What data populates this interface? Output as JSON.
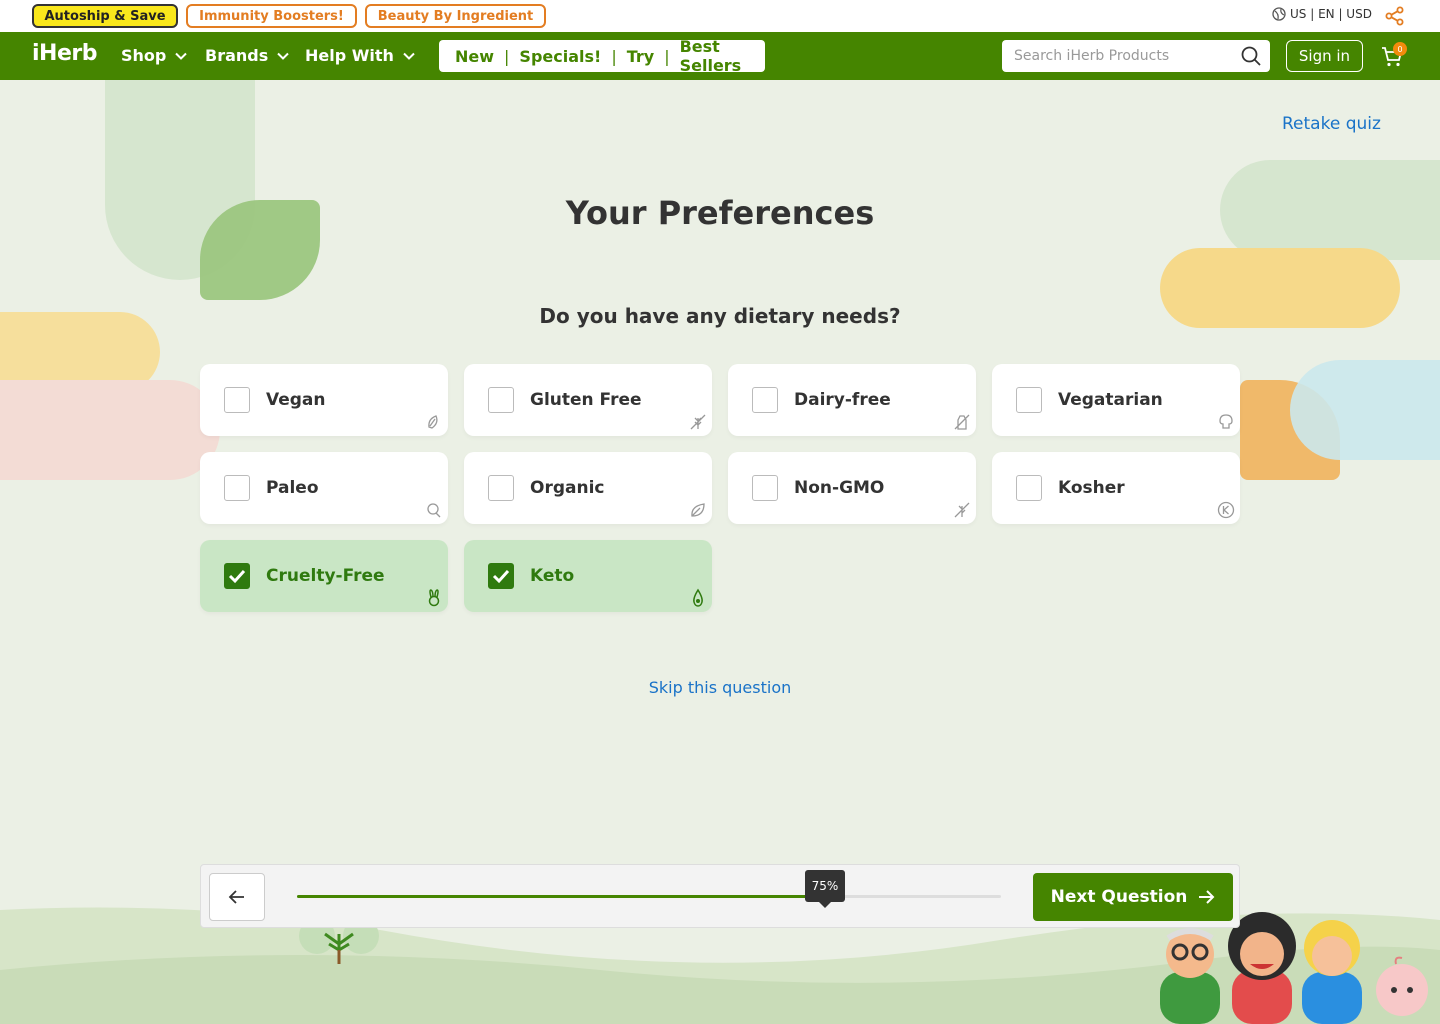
{
  "promo": {
    "autoship": "Autoship & Save",
    "immunity": "Immunity Boosters!",
    "beauty": "Beauty By Ingredient",
    "locale": "US | EN | USD"
  },
  "header": {
    "logo": "iHerb",
    "nav": [
      "Shop",
      "Brands",
      "Help With"
    ],
    "quick_links": [
      "New",
      "Specials!",
      "Try",
      "Best Sellers"
    ],
    "search_placeholder": "Search iHerb Products",
    "signin": "Sign in",
    "cart_count": "0"
  },
  "quiz": {
    "retake": "Retake quiz",
    "title": "Your Preferences",
    "question": "Do you have any dietary needs?",
    "options": [
      {
        "label": "Vegan",
        "checked": false,
        "icon": "vegan-icon"
      },
      {
        "label": "Gluten Free",
        "checked": false,
        "icon": "gluten-free-icon"
      },
      {
        "label": "Dairy-free",
        "checked": false,
        "icon": "dairy-free-icon"
      },
      {
        "label": "Vegatarian",
        "checked": false,
        "icon": "vegetarian-icon"
      },
      {
        "label": "Paleo",
        "checked": false,
        "icon": "paleo-icon"
      },
      {
        "label": "Organic",
        "checked": false,
        "icon": "organic-icon"
      },
      {
        "label": "Non-GMO",
        "checked": false,
        "icon": "non-gmo-icon"
      },
      {
        "label": "Kosher",
        "checked": false,
        "icon": "kosher-icon"
      },
      {
        "label": "Cruelty-Free",
        "checked": true,
        "icon": "rabbit-icon"
      },
      {
        "label": "Keto",
        "checked": true,
        "icon": "avocado-icon"
      }
    ],
    "skip": "Skip this question"
  },
  "progress": {
    "value": 0.75,
    "label": "75%",
    "next": "Next Question"
  },
  "colors": {
    "brand_green": "#458500",
    "link_blue": "#1a73c8",
    "accent_orange": "#e37d22"
  }
}
